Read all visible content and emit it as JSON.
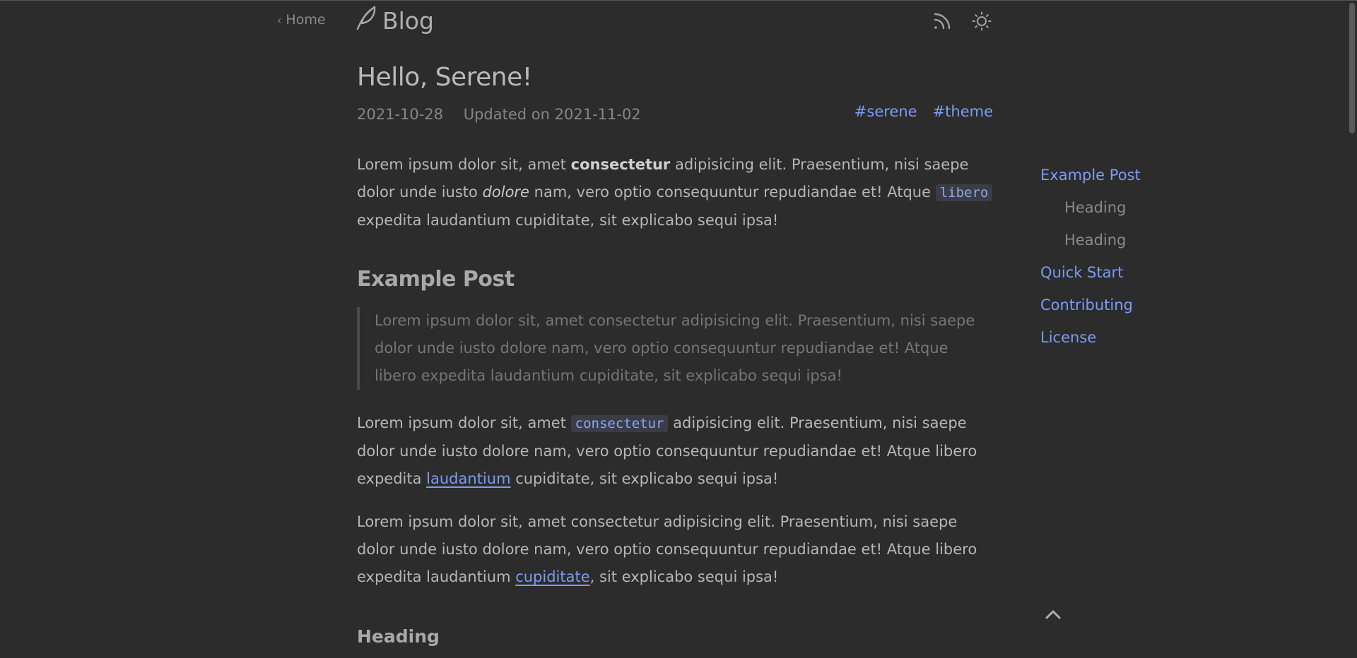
{
  "header": {
    "home_label": "Home",
    "blog_title": "Blog"
  },
  "post": {
    "title": "Hello, Serene!",
    "date": "2021-10-28",
    "updated": "Updated on 2021-11-02",
    "tags": [
      "#serene",
      "#theme"
    ]
  },
  "content": {
    "p1": {
      "a": "Lorem ipsum dolor sit, amet ",
      "bold": "consectetur",
      "b": " adipisicing elit. Praesentium, nisi saepe dolor unde iusto ",
      "italic": "dolore",
      "c": " nam, vero optio consequuntur repudiandae et! Atque ",
      "code": "libero",
      "d": " expedita laudantium cupiditate, sit explicabo sequi ipsa!"
    },
    "h2": "Example Post",
    "blockquote": "Lorem ipsum dolor sit, amet consectetur adipisicing elit. Praesentium, nisi saepe dolor unde iusto dolore nam, vero optio consequuntur repudiandae et! Atque libero expedita laudantium cupiditate, sit explicabo sequi ipsa!",
    "p2": {
      "a": "Lorem ipsum dolor sit, amet ",
      "code": "consectetur",
      "b": " adipisicing elit. Praesentium, nisi saepe dolor unde iusto dolore nam, vero optio consequuntur repudiandae et! Atque libero expedita ",
      "link": "laudantium",
      "c": " cupiditate, sit explicabo sequi ipsa!"
    },
    "p3": {
      "a": "Lorem ipsum dolor sit, amet consectetur adipisicing elit. Praesentium, nisi saepe dolor unde iusto dolore nam, vero optio consequuntur repudiandae et! Atque libero expedita laudantium ",
      "link": "cupiditate",
      "b": ", sit explicabo sequi ipsa!"
    },
    "h3": "Heading"
  },
  "toc": [
    {
      "label": "Example Post",
      "level": 1
    },
    {
      "label": "Heading",
      "level": 2
    },
    {
      "label": "Heading",
      "level": 2
    },
    {
      "label": "Quick Start",
      "level": 1
    },
    {
      "label": "Contributing",
      "level": 1
    },
    {
      "label": "License",
      "level": 1
    }
  ],
  "icons": {
    "feather": "feather-icon",
    "rss": "rss-icon",
    "theme_toggle": "sun-icon",
    "back_to_top": "chevron-up-icon"
  },
  "colors": {
    "background": "#2c2c2c",
    "accent": "#7b9cf4",
    "text": "#b6b6b6",
    "muted": "#868686"
  }
}
